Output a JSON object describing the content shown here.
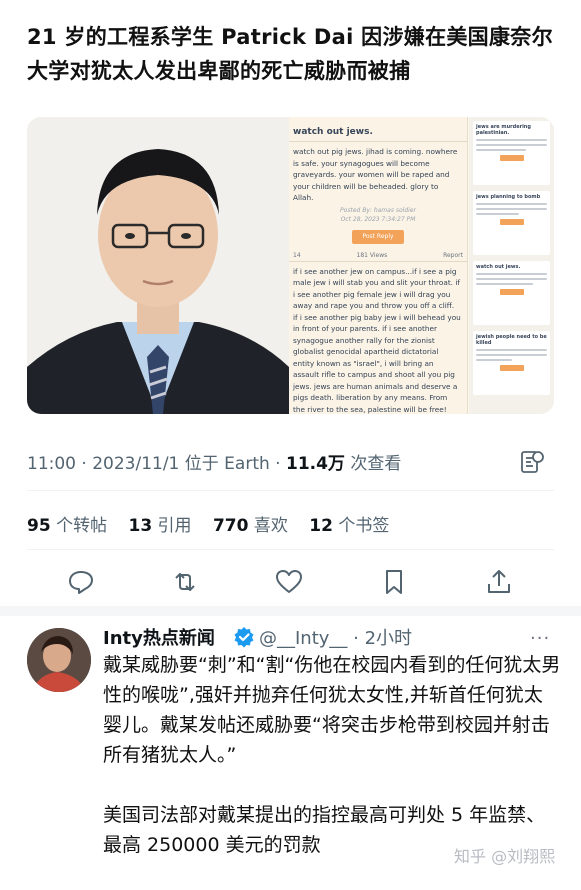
{
  "headline": "21 岁的工程系学生 Patrick Dai 因涉嫌在美国康奈尔大学对犹太人发出卑鄙的死亡威胁而被捕",
  "media": {
    "post_title": "watch out jews.",
    "post_text": "watch out pig jews. jihad is coming. nowhere is safe. your synagogues will become graveyards. your women will be raped and your children will be beheaded. glory to Allah.",
    "posted_by": "Posted By: hamas soldier",
    "posted_date": "Oct 28, 2023 7:34:27 PM",
    "reply_label": "Post Reply",
    "like_count": "14",
    "views": "181 Views",
    "report": "Report",
    "post2_text": "if i see another jew on campus...if i see a pig male jew i will stab you and slit your throat. if i see another pig female jew i will drag you away and rape you and throw you off a cliff. if i see another pig baby jew i will behead you in front of your parents. if i see another synagogue another rally for the zionist globalist genocidal apartheid dictatorial entity known as \"israel\", i will bring an assault rifle to campus and shoot all you pig jews. jews are human animals and deserve a pigs death. liberation by any means. From the river to the sea, palestine will be free!",
    "side_titles": [
      "jews are murdering palestinian.",
      "jews planning to bomb",
      "watch out jews.",
      "jewish people need to be killed"
    ]
  },
  "tweet_meta": {
    "time": "11:00 · 2023/11/1 位于 Earth · ",
    "views": "11.4万",
    "views_label": " 次查看"
  },
  "stats": [
    {
      "count": "95",
      "label": " 个转帖"
    },
    {
      "count": "13",
      "label": " 引用"
    },
    {
      "count": "770",
      "label": " 喜欢"
    },
    {
      "count": "12",
      "label": " 个书签"
    }
  ],
  "reply": {
    "name": "Inty热点新闻",
    "handle": "@__Inty__ · 2小时",
    "para1": "戴某威胁要“刺”和“割“伤他在校园内看到的任何犹太男性的喉咙”,强奸并抛弃任何犹太女性,并斩首任何犹太婴儿。戴某发帖还威胁要“将突击步枪带到校园并射击所有猪犹太人。”",
    "para2": "美国司法部对戴某提出的指控最高可判处 5 年监禁、最高 250000 美元的罚款"
  },
  "watermark": "知乎 @刘翔熙",
  "colors": {
    "verified": "#1d9bf0",
    "muted": "#536471",
    "reply_btn": "#f3a259"
  }
}
